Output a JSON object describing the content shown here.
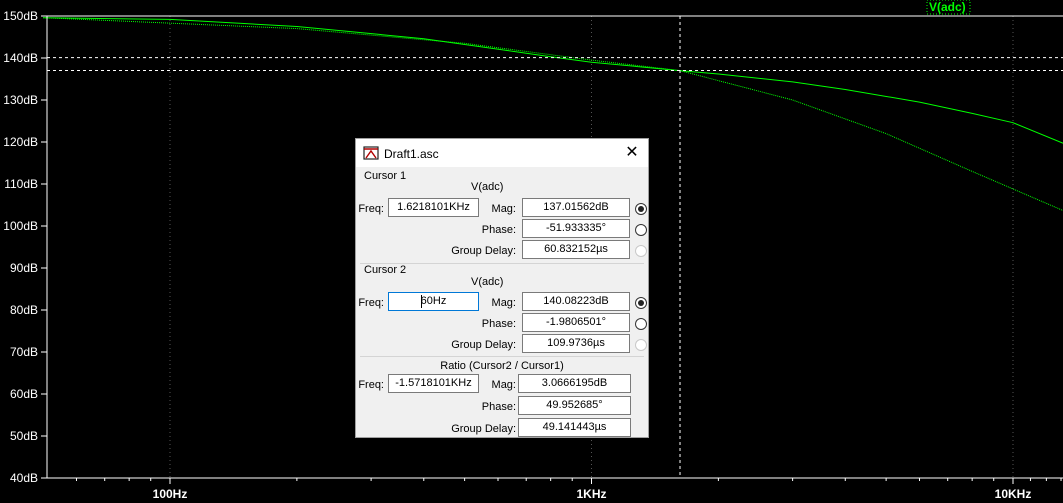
{
  "plot": {
    "trace_label": "V(adc)",
    "y_ticks": [
      "150dB",
      "140dB",
      "130dB",
      "120dB",
      "110dB",
      "100dB",
      "90dB",
      "80dB",
      "70dB",
      "60dB",
      "50dB",
      "40dB"
    ],
    "x_ticks": [
      "100Hz",
      "1KHz",
      "10KHz"
    ],
    "colors": {
      "background": "#000000",
      "trace": "#00ff00",
      "cursor": "#ffffff"
    }
  },
  "chart_data": {
    "type": "line",
    "title": "",
    "xlabel": "",
    "ylabel": "",
    "x_scale": "log",
    "xlim_hz": [
      50,
      14000
    ],
    "ylim_db": [
      40,
      150
    ],
    "series": [
      {
        "name": "V(adc)",
        "x_hz": [
          50,
          100,
          200,
          400,
          800,
          1000,
          1621.8,
          2000,
          3000,
          4000,
          6000,
          8000,
          10000,
          14000
        ],
        "y_db": [
          149.6,
          149.2,
          147.5,
          144.6,
          140.3,
          139.0,
          137.0,
          136.2,
          134.3,
          132.5,
          129.5,
          126.8,
          124.6,
          118.6
        ]
      }
    ],
    "cursor_1_hz": 1621.8101,
    "cursor_2_hz": 60,
    "cursor_1_db": 137.01562,
    "cursor_2_db": 140.08223
  },
  "dialog": {
    "title": "Draft1.asc",
    "cursor1": {
      "section": "Cursor 1",
      "trace": "V(adc)",
      "freq_label": "Freq:",
      "freq": "1.6218101KHz",
      "mag_label": "Mag:",
      "mag": "137.01562dB",
      "phase_label": "Phase:",
      "phase": "-51.933335°",
      "gd_label": "Group Delay:",
      "gd": "60.832152µs"
    },
    "cursor2": {
      "section": "Cursor 2",
      "trace": "V(adc)",
      "freq_label": "Freq:",
      "freq": "60Hz",
      "mag_label": "Mag:",
      "mag": "140.08223dB",
      "phase_label": "Phase:",
      "phase": "-1.9806501°",
      "gd_label": "Group Delay:",
      "gd": "109.9736µs"
    },
    "ratio": {
      "section": "Ratio (Cursor2 / Cursor1)",
      "freq_label": "Freq:",
      "freq": "-1.5718101KHz",
      "mag_label": "Mag:",
      "mag": "3.0666195dB",
      "phase_label": "Phase:",
      "phase": "49.952685°",
      "gd_label": "Group Delay:",
      "gd": "49.141443µs"
    }
  }
}
